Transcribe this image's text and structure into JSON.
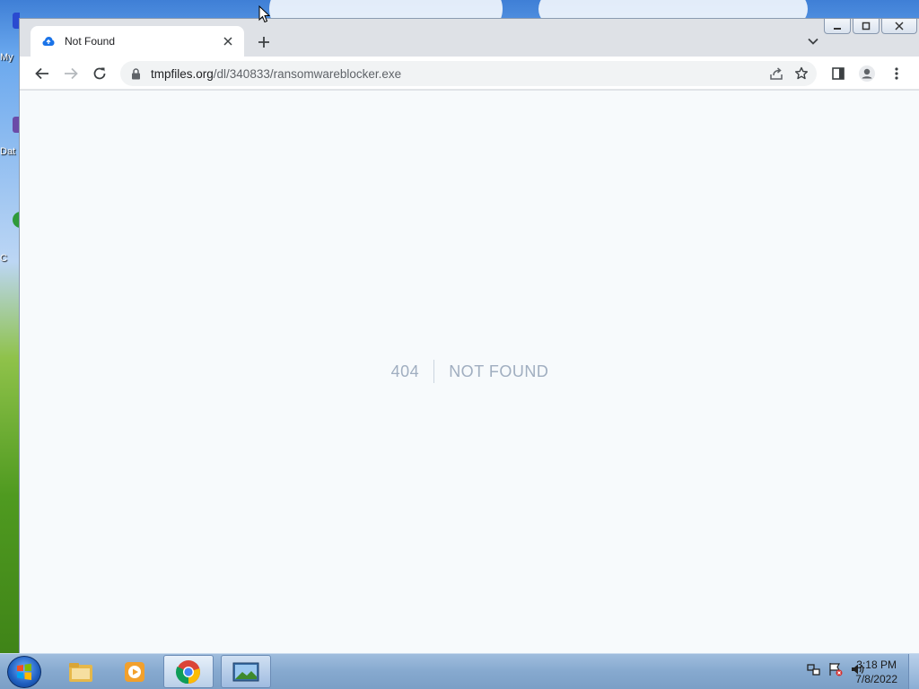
{
  "desktop": {
    "icons": [
      {
        "label": "My"
      },
      {
        "label": "Dat"
      },
      {
        "label": "C"
      }
    ]
  },
  "browser": {
    "tab": {
      "title": "Not Found"
    },
    "address": {
      "host": "tmpfiles.org",
      "path": "/dl/340833/ransomwareblocker.exe"
    }
  },
  "page": {
    "code": "404",
    "message": "NOT FOUND"
  },
  "taskbar": {
    "clock": {
      "time": "3:18 PM",
      "date": "7/8/2022"
    }
  },
  "colors": {
    "page_bg": "#f7fafc",
    "error_text": "#a0aec0",
    "accent": "#1a73e8"
  }
}
